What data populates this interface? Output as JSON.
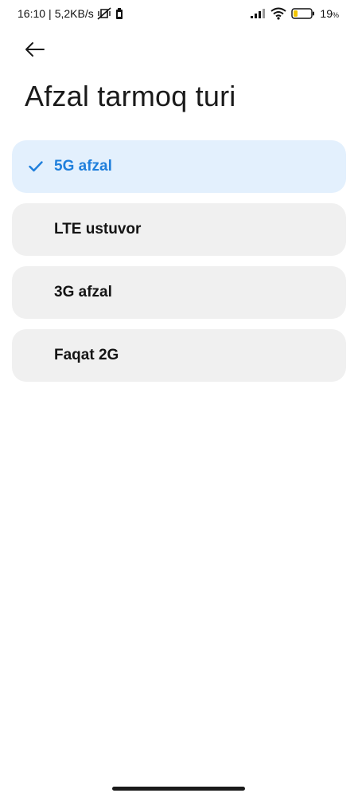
{
  "status_bar": {
    "time": "16:10",
    "separator": "|",
    "net_speed": "5,2KB/s",
    "battery_pct": "19",
    "battery_unit": "%",
    "icons": [
      "vibrate-off-icon",
      "battery-saver-icon",
      "signal-icon",
      "wifi-icon",
      "battery-icon"
    ]
  },
  "header": {
    "back_icon": "arrow-left-icon",
    "title": "Afzal tarmoq turi"
  },
  "options": [
    {
      "label": "5G afzal",
      "selected": true
    },
    {
      "label": "LTE ustuvor",
      "selected": false
    },
    {
      "label": "3G afzal",
      "selected": false
    },
    {
      "label": "Faqat 2G",
      "selected": false
    }
  ],
  "colors": {
    "accent": "#1f7fdc",
    "selected_bg": "#e3f0fd",
    "item_bg": "#f0f0f0",
    "battery_fill": "#f2c500"
  }
}
